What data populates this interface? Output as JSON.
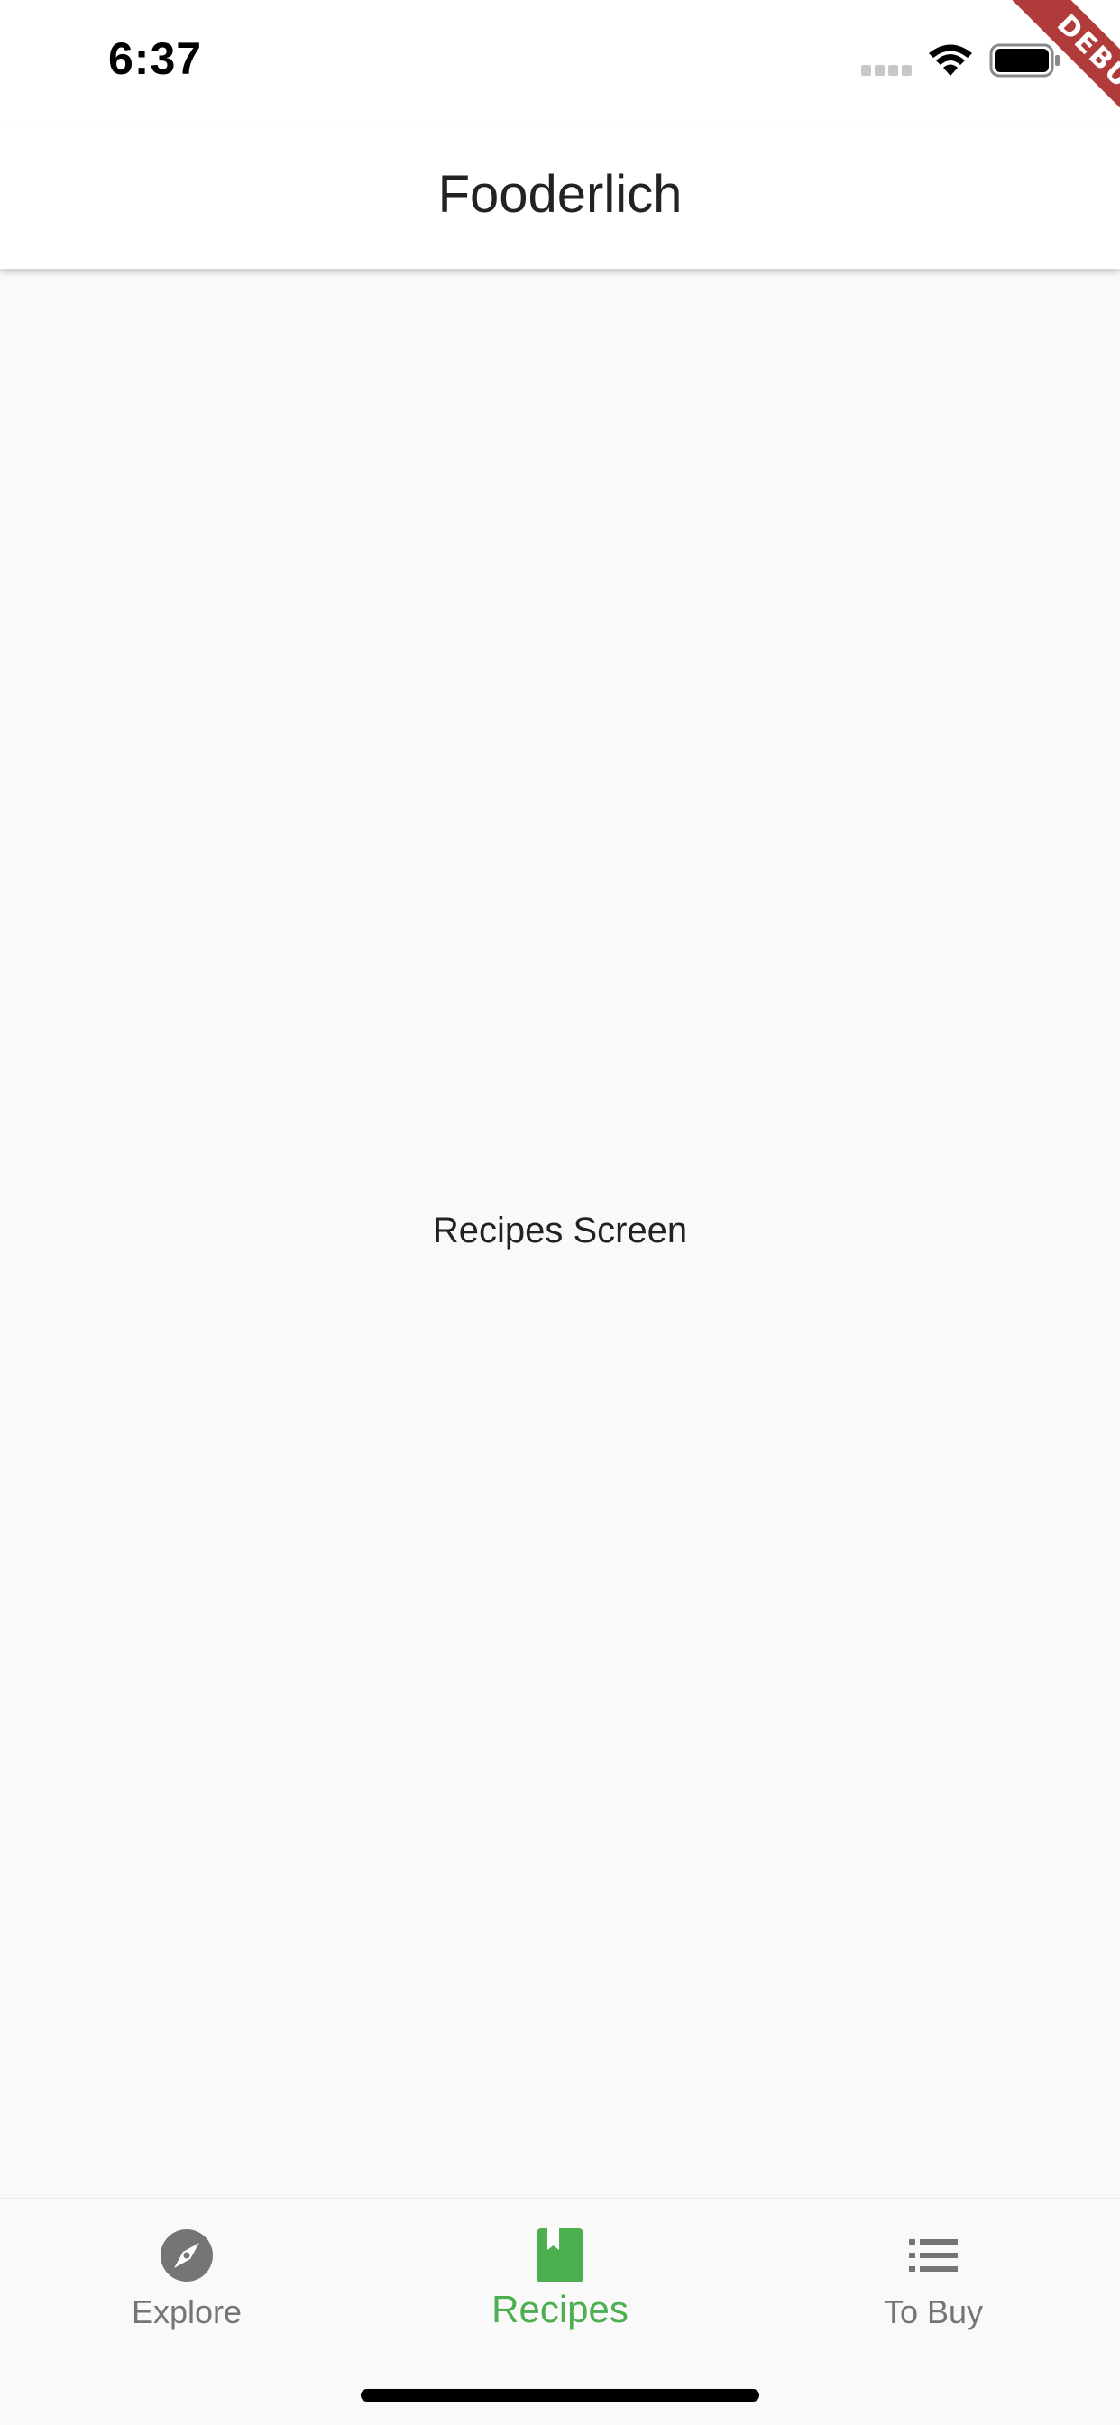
{
  "status_bar": {
    "time": "6:37"
  },
  "app_bar": {
    "title": "Fooderlich"
  },
  "body": {
    "label": "Recipes Screen"
  },
  "bottom_nav": {
    "items": [
      {
        "label": "Explore",
        "icon": "explore-icon",
        "active": false
      },
      {
        "label": "Recipes",
        "icon": "book-icon",
        "active": true
      },
      {
        "label": "To Buy",
        "icon": "list-icon",
        "active": false
      }
    ]
  },
  "debug_banner": "DEBUG",
  "colors": {
    "accent": "#4caf50",
    "inactive": "#757575",
    "background": "#f9f9f9",
    "app_bar": "#ffffff",
    "debug_banner": "#b13b3b"
  }
}
